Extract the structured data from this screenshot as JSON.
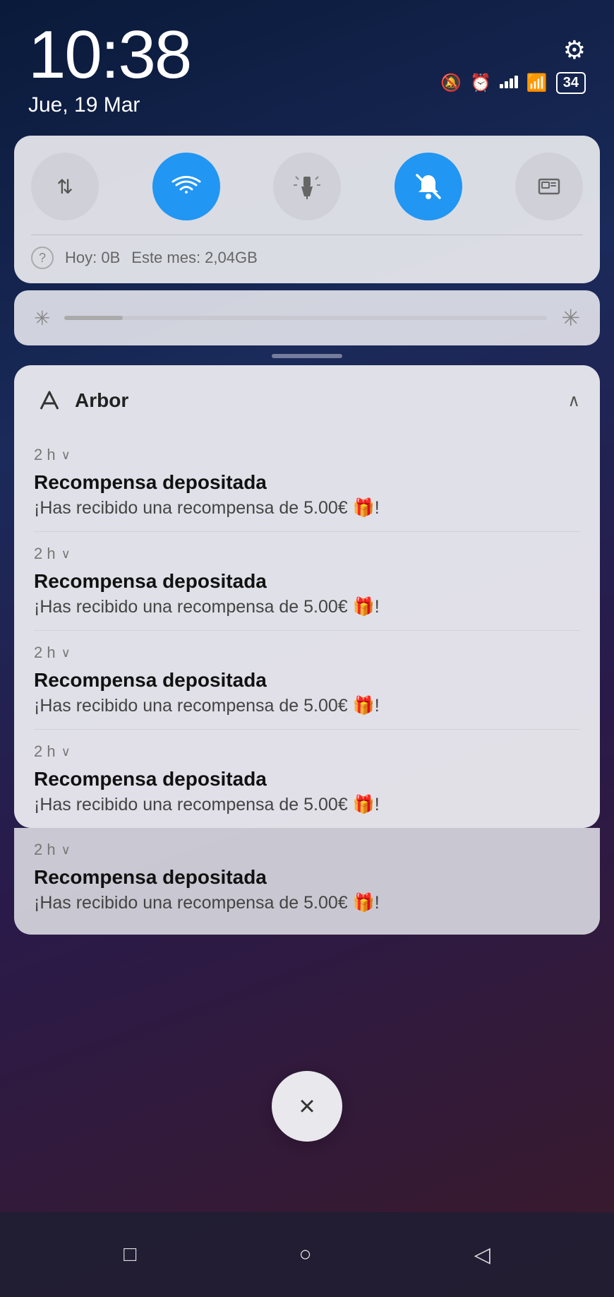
{
  "statusBar": {
    "time": "10:38",
    "date": "Jue, 19 Mar",
    "battery": "34",
    "signal": "4"
  },
  "quickSettings": {
    "buttons": [
      {
        "id": "rotate",
        "label": "⇅",
        "active": false
      },
      {
        "id": "wifi",
        "label": "wifi",
        "active": true
      },
      {
        "id": "torch",
        "label": "torch",
        "active": false
      },
      {
        "id": "silent",
        "label": "silent",
        "active": true
      },
      {
        "id": "screenshot",
        "label": "screenshot",
        "active": false
      }
    ],
    "dataToday": "Hoy: 0B",
    "dataMonth": "Este mes: 2,04GB"
  },
  "notifications": {
    "appName": "Arbor",
    "items": [
      {
        "time": "2 h",
        "title": "Recompensa depositada",
        "body": "¡Has recibido una recompensa de 5.00€ 🎁!"
      },
      {
        "time": "2 h",
        "title": "Recompensa depositada",
        "body": "¡Has recibido una recompensa de 5.00€ 🎁!"
      },
      {
        "time": "2 h",
        "title": "Recompensa depositada",
        "body": "¡Has recibido una recompensa de 5.00€ 🎁!"
      },
      {
        "time": "2 h",
        "title": "Recompensa depositada",
        "body": "¡Has recibido una recompensa de 5.00€ 🎁!"
      },
      {
        "time": "2 h",
        "title": "Recompensa depositada",
        "body": "¡Has recibido una recompensa de 5.00€ 🎁!"
      }
    ]
  },
  "closeButton": "×",
  "nav": {
    "back": "◁",
    "home": "○",
    "recents": "□"
  }
}
